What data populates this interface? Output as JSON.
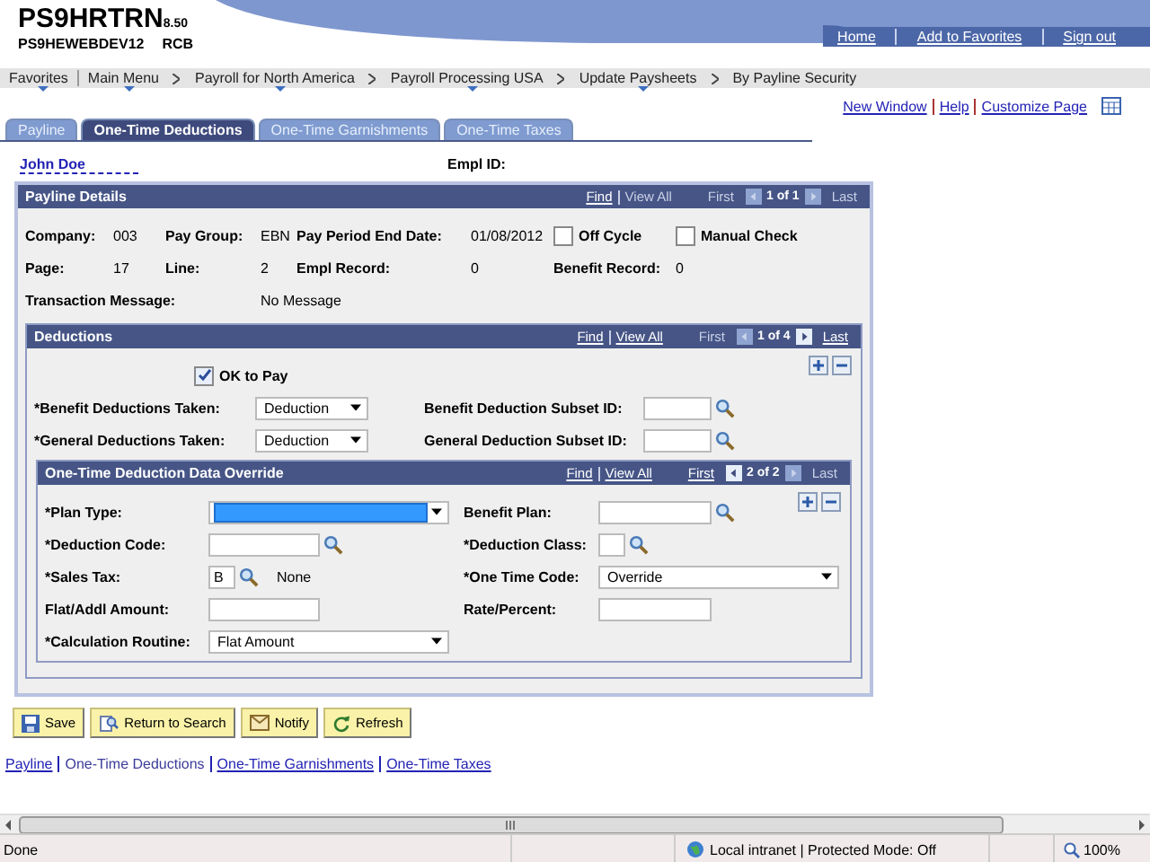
{
  "header": {
    "title": "PS9HRTRN",
    "version": "8.50",
    "database": "PS9HEWEBDEV12",
    "user": "RCB",
    "links": [
      "Home",
      "Add to Favorites",
      "Sign out"
    ]
  },
  "breadcrumbs": [
    {
      "label": "Favorites",
      "menu": true
    },
    {
      "label": "Main Menu",
      "menu": true
    },
    {
      "label": "Payroll for North America",
      "menu": true
    },
    {
      "label": "Payroll Processing USA",
      "menu": true
    },
    {
      "label": "Update Paysheets",
      "menu": true
    },
    {
      "label": "By Payline Security",
      "menu": false
    }
  ],
  "page_links": [
    "New Window",
    "Help",
    "Customize Page"
  ],
  "tabs": [
    {
      "label": "Payline",
      "selected": false
    },
    {
      "label": "One-Time Deductions",
      "selected": true
    },
    {
      "label": "One-Time Garnishments",
      "selected": false
    },
    {
      "label": "One-Time Taxes",
      "selected": false
    }
  ],
  "employee": {
    "name": "John Doe",
    "id_label": "Empl ID:"
  },
  "section": {
    "title": "Payline Details",
    "row_controls": false,
    "nav": {
      "links": [
        {
          "label": "Find",
          "enabled": true
        },
        {
          "label": "View All",
          "enabled": false
        }
      ],
      "first": {
        "label": "First",
        "enabled": false
      },
      "prev_enabled": false,
      "count": "1 of 1",
      "next_enabled": false,
      "last": {
        "label": "Last",
        "enabled": false
      }
    },
    "rows": [
      [
        {
          "kind": "label",
          "text": "Company:"
        },
        {
          "kind": "value",
          "text": "003"
        },
        {
          "kind": "label",
          "text": "Pay Group:"
        },
        {
          "kind": "value",
          "text": "EBN"
        },
        {
          "kind": "label",
          "text": "Pay Period End Date:"
        },
        {
          "kind": "value",
          "text": "01/08/2012"
        },
        {
          "kind": "checkbox",
          "text": "Off Cycle",
          "checked": false
        },
        {
          "kind": "checkbox",
          "text": "Manual Check",
          "checked": false
        }
      ],
      [
        {
          "kind": "label",
          "text": "Page:"
        },
        {
          "kind": "value",
          "text": "17"
        },
        {
          "kind": "label",
          "text": "Line:"
        },
        {
          "kind": "value",
          "text": "2"
        },
        {
          "kind": "label",
          "text": "Empl Record:"
        },
        {
          "kind": "value",
          "text": "0"
        },
        {
          "kind": "label",
          "text": "Benefit Record:"
        },
        {
          "kind": "value",
          "text": "0"
        }
      ],
      [
        {
          "kind": "label",
          "text": "Transaction Message:"
        },
        {
          "kind": "empty"
        },
        {
          "kind": "empty"
        },
        {
          "kind": "value",
          "text": "No Message"
        }
      ]
    ],
    "subsection": {
      "title": "Deductions",
      "row_controls": true,
      "nav": {
        "links": [
          {
            "label": "Find",
            "enabled": true
          },
          {
            "label": "View All",
            "enabled": true
          }
        ],
        "first": {
          "label": "First",
          "enabled": false
        },
        "prev_enabled": false,
        "count": "1 of 4",
        "next_enabled": true,
        "last": {
          "label": "Last",
          "enabled": true
        }
      },
      "rows": [
        [
          {
            "kind": "checkbox",
            "text": "OK to Pay",
            "checked": true
          }
        ],
        [
          {
            "kind": "label",
            "text": "*Benefit Deductions Taken:"
          },
          {
            "kind": "select",
            "value": "Deduction",
            "focused": false
          },
          {
            "kind": "label",
            "text": "Benefit Deduction Subset ID:"
          },
          {
            "kind": "input",
            "lookup": true
          }
        ],
        [
          {
            "kind": "label",
            "text": "*General Deductions Taken:"
          },
          {
            "kind": "select",
            "value": "Deduction",
            "focused": false
          },
          {
            "kind": "label",
            "text": "General Deduction Subset ID:"
          },
          {
            "kind": "input",
            "lookup": true
          }
        ]
      ],
      "subsection": {
        "title": "One-Time Deduction Data Override",
        "row_controls": true,
        "nav": {
          "links": [
            {
              "label": "Find",
              "enabled": true
            },
            {
              "label": "View All",
              "enabled": true
            }
          ],
          "first": {
            "label": "First",
            "enabled": true
          },
          "prev_enabled": true,
          "count": "2 of 2",
          "next_enabled": false,
          "last": {
            "label": "Last",
            "enabled": false
          }
        },
        "rows": [
          [
            {
              "kind": "label",
              "text": "*Plan Type:"
            },
            {
              "kind": "select",
              "focused": true
            },
            {
              "kind": "label",
              "text": "Benefit Plan:"
            },
            {
              "kind": "input",
              "lookup": true
            }
          ],
          [
            {
              "kind": "label",
              "text": "*Deduction Code:"
            },
            {
              "kind": "input",
              "lookup": true
            },
            {
              "kind": "label",
              "text": "*Deduction Class:"
            },
            {
              "kind": "input",
              "lookup": true
            }
          ],
          [
            {
              "kind": "label",
              "text": "*Sales Tax:"
            },
            {
              "kind": "input",
              "value": "B",
              "lookup": true,
              "description": "None"
            },
            {
              "kind": "label",
              "text": "*One Time Code:"
            },
            {
              "kind": "select",
              "value": "Override",
              "focused": false
            }
          ],
          [
            {
              "kind": "label",
              "text": "Flat/Addl Amount:"
            },
            {
              "kind": "input",
              "lookup": false
            },
            {
              "kind": "label",
              "text": "Rate/Percent:"
            },
            {
              "kind": "input",
              "lookup": false
            }
          ],
          [
            {
              "kind": "label",
              "text": "*Calculation Routine:"
            },
            {
              "kind": "select",
              "value": "Flat Amount",
              "focused": false
            }
          ]
        ]
      }
    }
  },
  "toolbar": [
    {
      "label": "Save",
      "kind": "save"
    },
    {
      "label": "Return to Search",
      "kind": "search"
    },
    {
      "label": "Notify",
      "kind": "notify"
    },
    {
      "label": "Refresh",
      "kind": "refresh"
    }
  ],
  "footer_links": [
    {
      "label": "Payline",
      "selected": false
    },
    {
      "label": "One-Time Deductions",
      "selected": true
    },
    {
      "label": "One-Time Garnishments",
      "selected": false
    },
    {
      "label": "One-Time Taxes",
      "selected": false
    }
  ],
  "status_bar": {
    "text": "Done",
    "zone": "Local intranet | Protected Mode: Off",
    "zoom": "100%"
  }
}
